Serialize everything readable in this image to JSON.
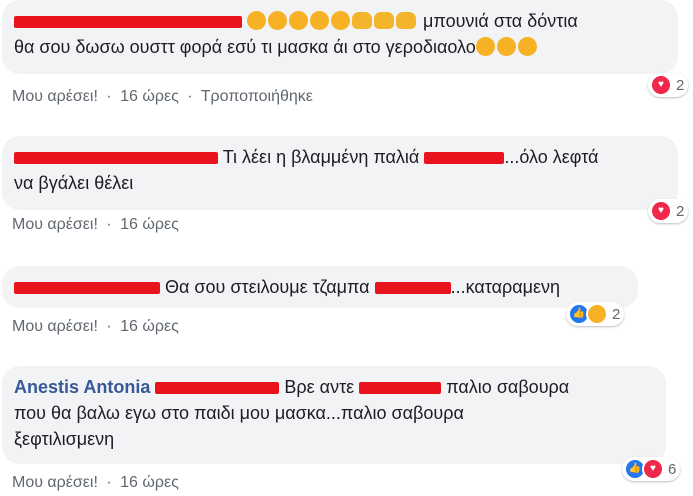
{
  "comments": [
    {
      "text_line1": "μπουνιά στα δόντια",
      "text_line2": "θα σου δωσω ουσττ φορά εσύ τι μασκα άι στο γεροδιαολο",
      "actions": {
        "like": "Μου αρέσει!",
        "time": "16 ώρες",
        "edited": "Τροποποιήθηκε"
      },
      "reaction_count": "2"
    },
    {
      "text_a": "Τι λέει η βλαμμένη παλιά",
      "text_b": "...όλο λεφτά",
      "text_line2": "να βγάλει θέλει",
      "actions": {
        "like": "Μου αρέσει!",
        "time": "16 ώρες"
      },
      "reaction_count": "2"
    },
    {
      "text_a": "Θα σου στειλουμε τζαμπα",
      "text_b": "...καταραμενη",
      "actions": {
        "like": "Μου αρέσει!",
        "time": "16 ώρες"
      },
      "reaction_count": "2"
    },
    {
      "author": "Anestis Antonia",
      "text_a": "Βρε αντε",
      "text_b": "παλιο σαβουρα",
      "text_line2": "που θα βαλω εγω στο παιδι μου μασκα...παλιο σαβουρα",
      "text_line3": "ξεφτιλισμενη",
      "actions": {
        "like": "Μου αρέσει!",
        "time": "16 ώρες"
      },
      "reaction_count": "6"
    }
  ],
  "separator": "·",
  "colors": {
    "bubble": "#f2f3f5",
    "name": "#385898",
    "redaction": "#e8131c",
    "meta": "#606770"
  }
}
